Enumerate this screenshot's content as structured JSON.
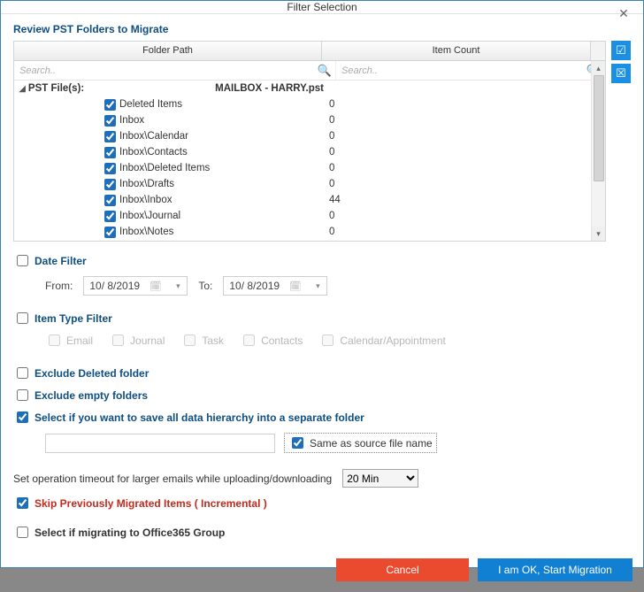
{
  "window": {
    "title": "Filter Selection"
  },
  "header": "Review PST Folders to Migrate",
  "grid": {
    "col_path": "Folder Path",
    "col_count": "Item Count",
    "search_placeholder_path": "Search..",
    "search_placeholder_count": "Search..",
    "root_prefix": "PST File(s):",
    "root_suffix": "MAILBOX - HARRY.pst",
    "rows": [
      {
        "name": "Deleted Items",
        "count": "0",
        "indent": 1,
        "checked": true
      },
      {
        "name": "Inbox",
        "count": "0",
        "indent": 1,
        "checked": true
      },
      {
        "name": "Inbox\\Calendar",
        "count": "0",
        "indent": 1,
        "checked": true
      },
      {
        "name": "Inbox\\Contacts",
        "count": "0",
        "indent": 1,
        "checked": true
      },
      {
        "name": "Inbox\\Deleted Items",
        "count": "0",
        "indent": 1,
        "checked": true
      },
      {
        "name": "Inbox\\Drafts",
        "count": "0",
        "indent": 1,
        "checked": true
      },
      {
        "name": "Inbox\\Inbox",
        "count": "44",
        "indent": 1,
        "checked": true
      },
      {
        "name": "Inbox\\Journal",
        "count": "0",
        "indent": 1,
        "checked": true
      },
      {
        "name": "Inbox\\Notes",
        "count": "0",
        "indent": 1,
        "checked": true
      }
    ]
  },
  "date_filter": {
    "label": "Date Filter",
    "from_label": "From:",
    "to_label": "To:",
    "from_value": "10/  8/2019",
    "to_value": "10/  8/2019"
  },
  "item_filter": {
    "label": "Item Type Filter",
    "types": {
      "email": "Email",
      "journal": "Journal",
      "task": "Task",
      "contacts": "Contacts",
      "calendar": "Calendar/Appointment"
    }
  },
  "excl_deleted": "Exclude Deleted folder",
  "excl_empty": "Exclude empty folders",
  "hierarchy_label": "Select if you want to save all data hierarchy into a separate folder",
  "same_source": "Same as source file name",
  "sep_folder_value": "",
  "timeout_label": "Set operation timeout for larger emails while uploading/downloading",
  "timeout_value": "20 Min",
  "skip_label": "Skip Previously Migrated Items ( Incremental )",
  "o365_label": "Select if migrating to Office365 Group",
  "buttons": {
    "cancel": "Cancel",
    "start": "I am OK, Start Migration"
  }
}
